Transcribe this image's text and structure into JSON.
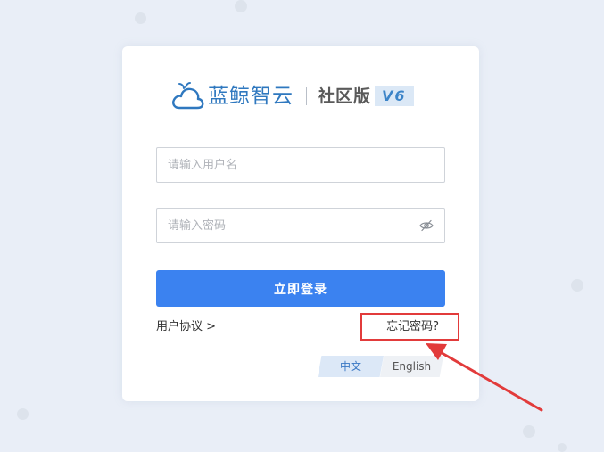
{
  "logo": {
    "brand": "蓝鲸智云",
    "edition": "社区版",
    "version": "V6"
  },
  "login_form": {
    "username_placeholder": "请输入用户名",
    "password_placeholder": "请输入密码",
    "login_label": "立即登录",
    "agreement_label": "用户协议 >",
    "forgot_label": "忘记密码?"
  },
  "language": {
    "options": [
      "中文",
      "English"
    ],
    "selected": "中文"
  },
  "colors": {
    "primary": "#3b82f0",
    "brand": "#2f78bf",
    "annotation": "#e23b3b",
    "background": "#e9eef7"
  },
  "icons": {
    "logo": "cloud-logo-icon",
    "password_toggle": "eye-off-icon"
  }
}
